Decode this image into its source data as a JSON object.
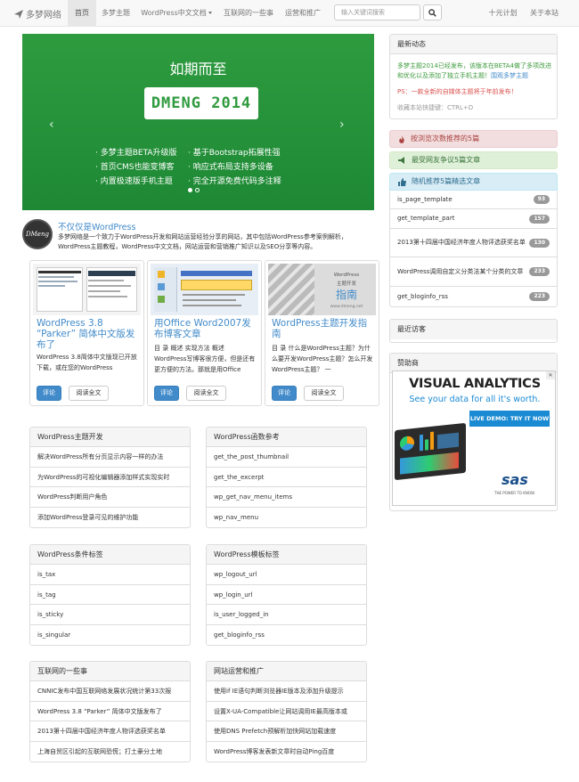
{
  "nav": {
    "brand": "多梦网络",
    "items": [
      "首页",
      "多梦主题",
      "WordPress中文文档",
      "互联网的一些事",
      "运营和推广"
    ],
    "search_placeholder": "输入关键词搜索",
    "right_items": [
      "十元计划",
      "关于本站"
    ]
  },
  "carousel": {
    "title": "如期而至",
    "logo_text": "DMENG 2014",
    "features": [
      "· 多梦主题BETA升级版",
      "· 首页CMS也能变博客",
      "· 内置极速版手机主题",
      "· 基于Bootstrap拓展性强",
      "· 响应式布局支持多设备",
      "· 完全开源免费代码多注释"
    ],
    "prev": "‹",
    "next": "›"
  },
  "intro": {
    "logo_text": "DMeng",
    "title": "不仅仅是WordPress",
    "text": "多梦网络是一个致力于WordPress开发和网站运营经验分享的网站，其中包括WordPress参考案例解析，WordPress主题教程，WordPress中文文档，网站运营和营销推广知识以及SEO分享等内容。"
  },
  "cards": [
    {
      "title": "WordPress 3.8 “Parker” 简体中文版发布了",
      "desc": "WordPress 3.8简体中文版现已开放下载，或在您的WordPress",
      "comment": "评论",
      "read": "阅读全文"
    },
    {
      "title": "用Office Word2007发布博客文章",
      "desc": "目 录 概述 实现方法 概述 WordPress写博客很方便，但是还有更方便的方法。那就是用Office",
      "comment": "评论",
      "read": "阅读全文"
    },
    {
      "title": "WordPress主题开发指南",
      "desc": "目 录 什么是WordPress主题？为什么要开发WordPress主题？怎么开发WordPress主题？ 一",
      "comment": "评论",
      "read": "阅读全文",
      "thumb_line1": "WordPress",
      "thumb_line2": "主题开发",
      "thumb_line3": "指南",
      "thumb_url": "www.dmeng.net"
    }
  ],
  "panels": [
    {
      "title": "WordPress主题开发",
      "items": [
        "解决WordPress所有分页显示内容一样的办法",
        "为WordPress的可视化编辑器添加样式实现实时",
        "WordPress判断用户角色",
        "添加WordPress登录可见的维护功能"
      ]
    },
    {
      "title": "WordPress函数参考",
      "items": [
        "get_the_post_thumbnail",
        "get_the_excerpt",
        "wp_get_nav_menu_items",
        "wp_nav_menu"
      ]
    },
    {
      "title": "WordPress条件标签",
      "items": [
        "is_tax",
        "is_tag",
        "is_sticky",
        "is_singular"
      ]
    },
    {
      "title": "WordPress模板标签",
      "items": [
        "wp_logout_url",
        "wp_login_url",
        "is_user_logged_in",
        "get_bloginfo_rss"
      ]
    },
    {
      "title": "互联网的一些事",
      "items": [
        "CNNIC发布中国互联网络发展状况统计第33次报",
        "WordPress 3.8 “Parker” 简体中文版发布了",
        "2013第十四届中国经济年度人物评选获奖名单",
        "上海自贸区引起的互联网恐慌；打土豪分土地"
      ]
    },
    {
      "title": "网站运营和推广",
      "items": [
        "使用if IE语句判断浏览器IE版本及添加升级提示",
        "设置X-UA-Compatible让网站调用IE最高版本或",
        "使用DNS Prefetch预解析加快网站加载速度",
        "WordPress博客发表新文章时自动Ping百度"
      ]
    }
  ],
  "sidebar": {
    "news_title": "最新动态",
    "news_green": "多梦主题2014已经发布，该版本在BETA4做了多项改进和优化以及添加了独立手机主题！",
    "news_green_link": "围观多梦主题",
    "news_red": "PS：一款全新的自媒体主题将于年前发布！",
    "news_gray": "收藏本站快捷键：CTRL+D",
    "alert_danger": "按浏览次数推荐的5篇",
    "alert_success": "最受网友争议5篇文章",
    "alert_info": "随机推荐5篇精选文章",
    "random_list": [
      {
        "label": "is_page_template",
        "count": "93"
      },
      {
        "label": "get_template_part",
        "count": "157"
      },
      {
        "label": "2013第十四届中国经济年度人物评选获奖名单",
        "count": "130"
      },
      {
        "label": "WordPress调用自定义分类法某个分类的文章",
        "count": "233"
      },
      {
        "label": "get_bloginfo_rss",
        "count": "223"
      }
    ],
    "visitors_title": "最近访客",
    "sponsor_title": "赞助商"
  },
  "ad": {
    "headline": "VISUAL ANALYTICS",
    "subline": "See your data for all it's worth.",
    "cta": "LIVE DEMO: TRY IT NOW",
    "brand": "sas",
    "tagline": "THE POWER TO KNOW."
  },
  "colors": {
    "green": "#2a963c",
    "link": "#428bca"
  }
}
